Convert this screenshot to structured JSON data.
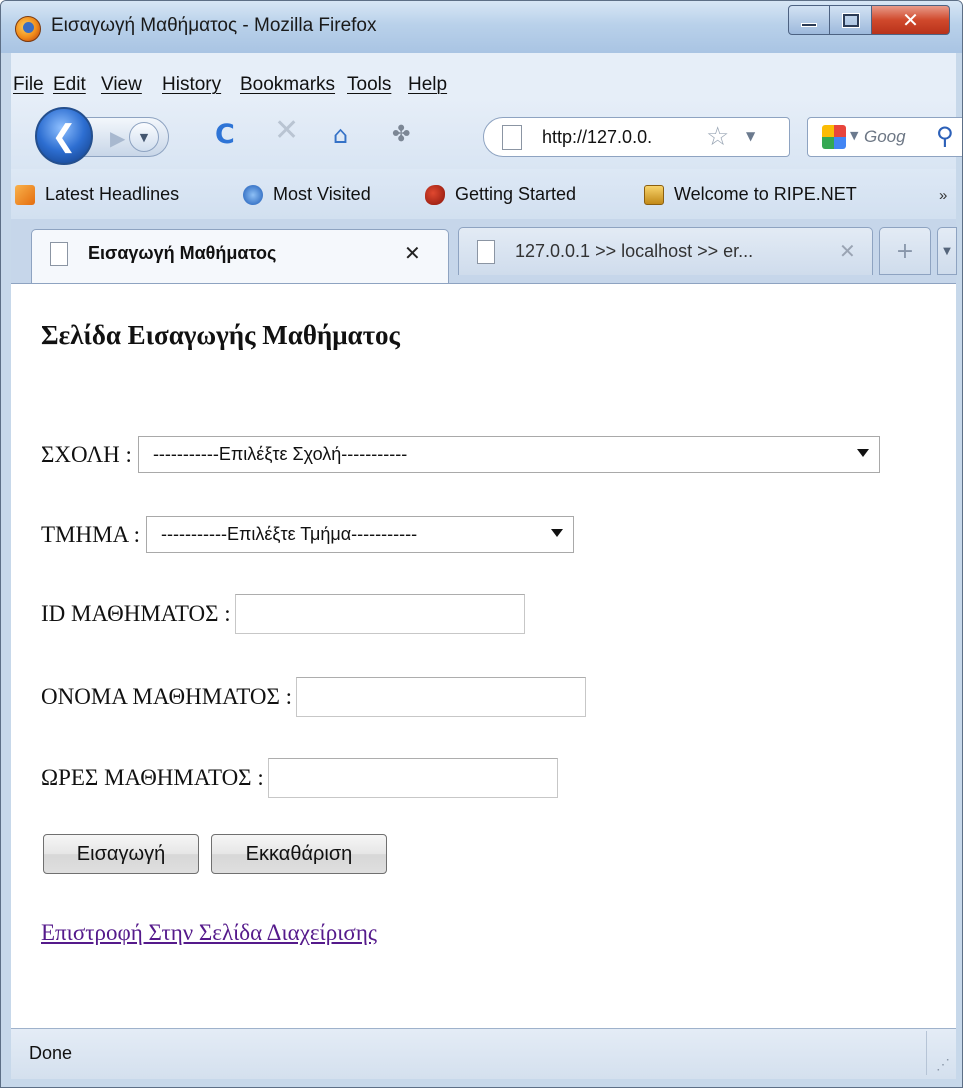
{
  "window": {
    "title": "Εισαγωγή Μαθήματος - Mozilla Firefox"
  },
  "menu": {
    "file": "File",
    "edit": "Edit",
    "view": "View",
    "history": "History",
    "bookmarks": "Bookmarks",
    "tools": "Tools",
    "help": "Help"
  },
  "navbar": {
    "url": "http://127.0.0.",
    "search_placeholder": "Goog"
  },
  "bookmarks_bar": {
    "items": [
      {
        "label": "Latest Headlines",
        "icon": "rss-icon"
      },
      {
        "label": "Most Visited",
        "icon": "most-visited-icon"
      },
      {
        "label": "Getting Started",
        "icon": "getting-started-icon"
      },
      {
        "label": "Welcome to RIPE.NET",
        "icon": "ripe-icon"
      }
    ],
    "more": "»"
  },
  "tabs": [
    {
      "label": "Εισαγωγή Μαθήματος",
      "active": true
    },
    {
      "label": "127.0.0.1 >> localhost >> er...",
      "active": false
    }
  ],
  "page": {
    "heading": "Σελίδα Εισαγωγής Μαθήματος",
    "school_label": "ΣΧΟΛΗ :",
    "school_selected": "-----------Επιλέξτε Σχολή-----------",
    "department_label": "ΤΜΗΜΑ :",
    "department_selected": "-----------Επιλέξτε Τμήμα-----------",
    "course_id_label": "ID ΜΑΘΗΜΑΤΟΣ :",
    "course_id_value": "",
    "course_name_label": "ΟΝΟΜΑ ΜΑΘΗΜΑΤΟΣ :",
    "course_name_value": "",
    "course_hours_label": "ΩΡΕΣ ΜΑΘΗΜΑΤΟΣ :",
    "course_hours_value": "",
    "insert_button": "Εισαγωγή",
    "clear_button": "Εκκαθάριση",
    "back_link": "Επιστροφή Στην Σελίδα Διαχείρισης"
  },
  "status": {
    "text": "Done"
  }
}
